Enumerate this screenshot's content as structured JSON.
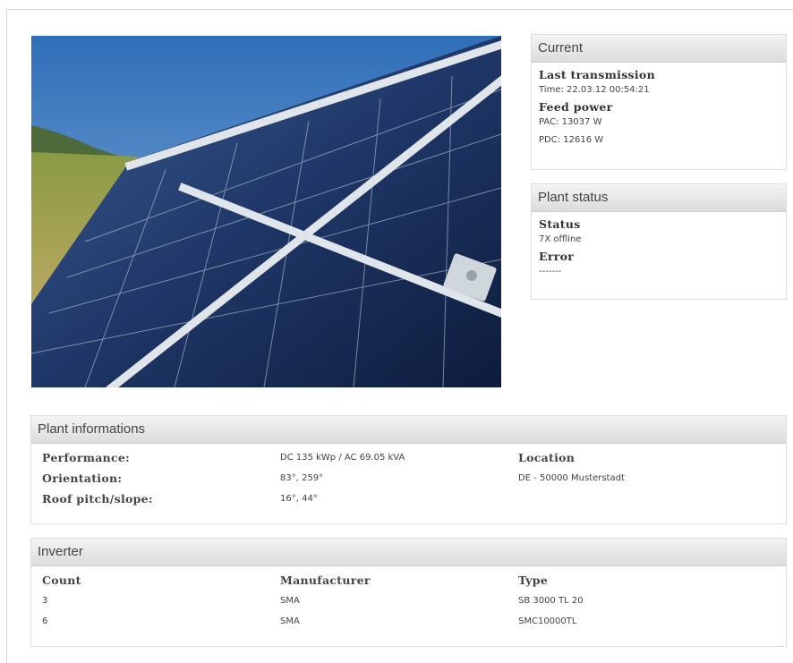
{
  "current": {
    "title": "Current",
    "last_transmission_label": "Last transmission",
    "time": "Time: 22.03.12 00:54:21",
    "feed_power_label": "Feed power",
    "pac": "PAC: 13037 W",
    "pdc": "PDC: 12616 W"
  },
  "plant_status": {
    "title": "Plant status",
    "status_label": "Status",
    "status_value": "7X offline",
    "error_label": "Error",
    "error_value": "-------"
  },
  "plant_info": {
    "title": "Plant informations",
    "performance_label": "Performance:",
    "performance_value": "DC 135 kWp / AC 69.05 kVA",
    "location_label": "Location",
    "orientation_label": "Orientation:",
    "orientation_value": "83°, 259°",
    "location_value": "DE - 50000 Musterstadt",
    "roof_label": "Roof pitch/slope:",
    "roof_value": "16°, 44°"
  },
  "inverter": {
    "title": "Inverter",
    "headers": [
      "Count",
      "Manufacturer",
      "Type"
    ],
    "rows": [
      [
        "3",
        "SMA",
        "SB 3000 TL 20"
      ],
      [
        "6",
        "SMA",
        "SMC10000TL"
      ]
    ]
  }
}
